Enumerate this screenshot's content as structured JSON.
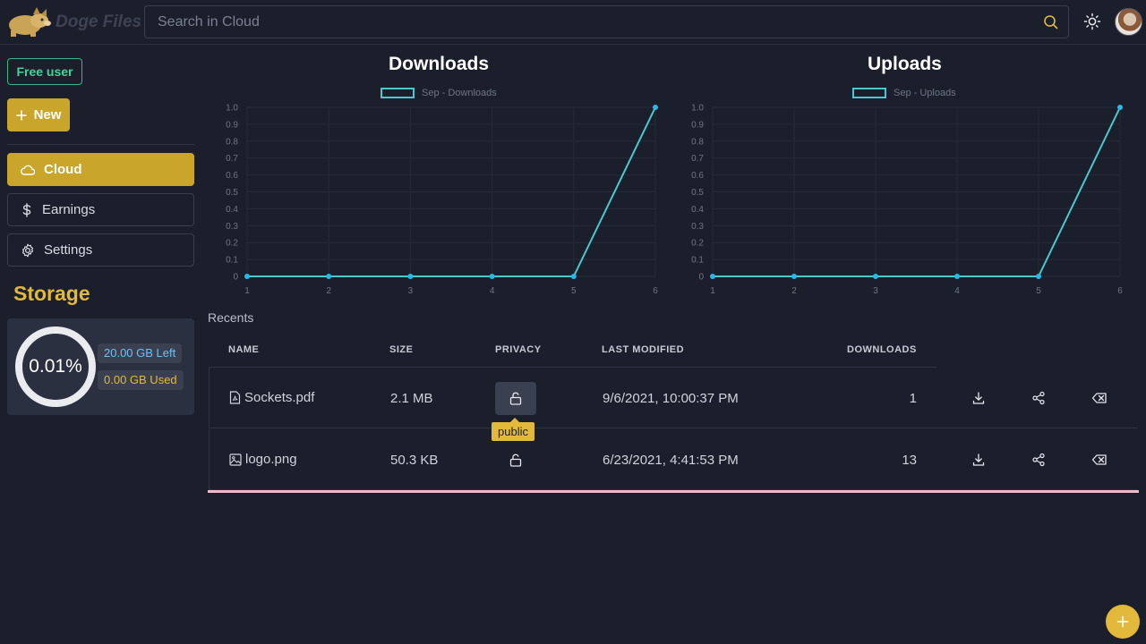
{
  "app": {
    "name": "Doge Files"
  },
  "search": {
    "placeholder": "Search in Cloud"
  },
  "sidebar": {
    "badge": "Free user",
    "new_label": "New",
    "items": [
      {
        "label": "Cloud",
        "icon": "cloud-icon",
        "active": true
      },
      {
        "label": "Earnings",
        "icon": "dollar-icon",
        "active": false
      },
      {
        "label": "Settings",
        "icon": "gear-icon",
        "active": false
      }
    ],
    "storage": {
      "title": "Storage",
      "percent": "0.01%",
      "left": "20.00 GB Left",
      "used": "0.00 GB Used"
    }
  },
  "chart_data": [
    {
      "type": "line",
      "title": "Downloads",
      "series": [
        {
          "name": "Sep - Downloads",
          "values": [
            0,
            0,
            0,
            0,
            0,
            1
          ]
        }
      ],
      "x": [
        1,
        2,
        3,
        4,
        5,
        6
      ],
      "ylim": [
        0,
        1.0
      ],
      "yticks": [
        "0",
        "0.1",
        "0.2",
        "0.3",
        "0.4",
        "0.5",
        "0.6",
        "0.7",
        "0.8",
        "0.9",
        "1.0"
      ],
      "legend": "top",
      "grid": true,
      "color": "#4bc8cc"
    },
    {
      "type": "line",
      "title": "Uploads",
      "series": [
        {
          "name": "Sep - Uploads",
          "values": [
            0,
            0,
            0,
            0,
            0,
            1
          ]
        }
      ],
      "x": [
        1,
        2,
        3,
        4,
        5,
        6
      ],
      "ylim": [
        0,
        1.0
      ],
      "yticks": [
        "0",
        "0.1",
        "0.2",
        "0.3",
        "0.4",
        "0.5",
        "0.6",
        "0.7",
        "0.8",
        "0.9",
        "1.0"
      ],
      "legend": "top",
      "grid": true,
      "color": "#4bc8cc"
    }
  ],
  "recents": {
    "title": "Recents",
    "columns": [
      "NAME",
      "SIZE",
      "PRIVACY",
      "LAST MODIFIED",
      "DOWNLOADS"
    ],
    "rows": [
      {
        "name": "Sockets.pdf",
        "icon": "pdf-file-icon",
        "size": "2.1 MB",
        "privacy": "public",
        "modified": "9/6/2021, 10:00:37 PM",
        "downloads": "1"
      },
      {
        "name": "logo.png",
        "icon": "image-file-icon",
        "size": "50.3 KB",
        "privacy": "public",
        "modified": "6/23/2021, 4:41:53 PM",
        "downloads": "13"
      }
    ],
    "tooltip": "public"
  },
  "colors": {
    "accent": "#c9a62b",
    "line": "#4bc8cc",
    "point": "#2fb6e8",
    "background": "#1b1f2b"
  }
}
